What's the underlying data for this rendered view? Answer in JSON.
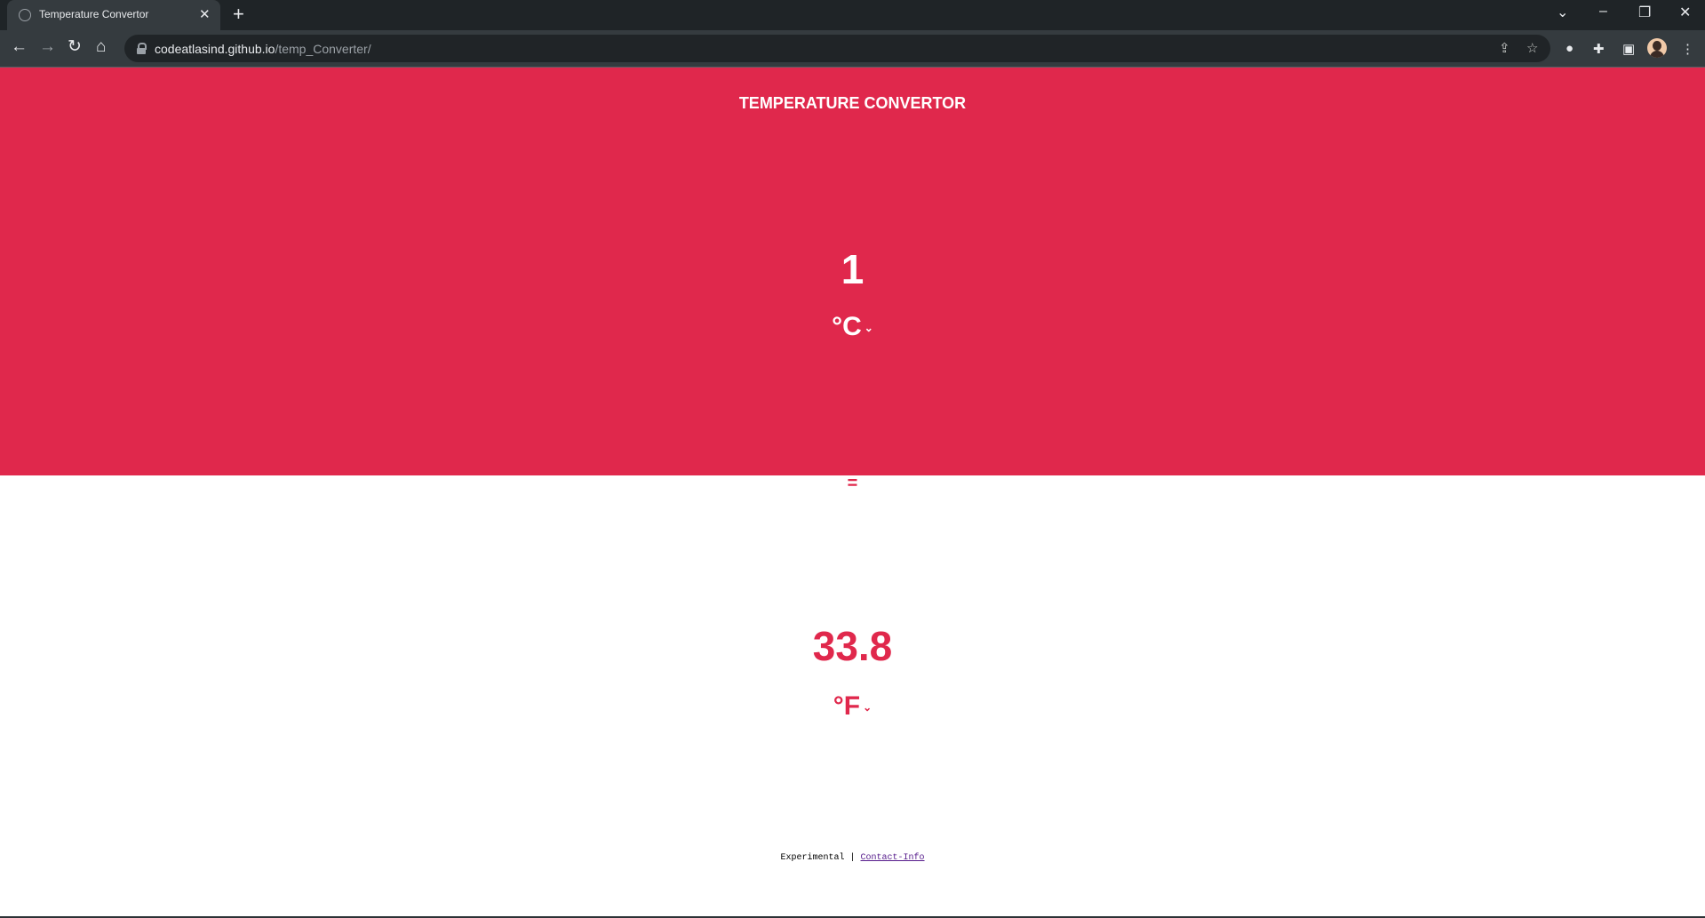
{
  "browser": {
    "tab_title": "Temperature Convertor",
    "new_tab_label": "+",
    "url_domain": "codeatlasind.github.io",
    "url_path": "/temp_Converter/"
  },
  "page": {
    "title": "TEMPERATURE CONVERTOR",
    "from_value": "1",
    "from_unit": "°C",
    "equals_sign": "=",
    "to_value": "33.8",
    "to_unit": "°F",
    "footer_text": "Experimental",
    "footer_separator": "|",
    "footer_link": "Contact-Info"
  },
  "colors": {
    "accent": "#e0284c",
    "chrome_dark": "#1f2427",
    "chrome_toolbar": "#353b3f"
  }
}
